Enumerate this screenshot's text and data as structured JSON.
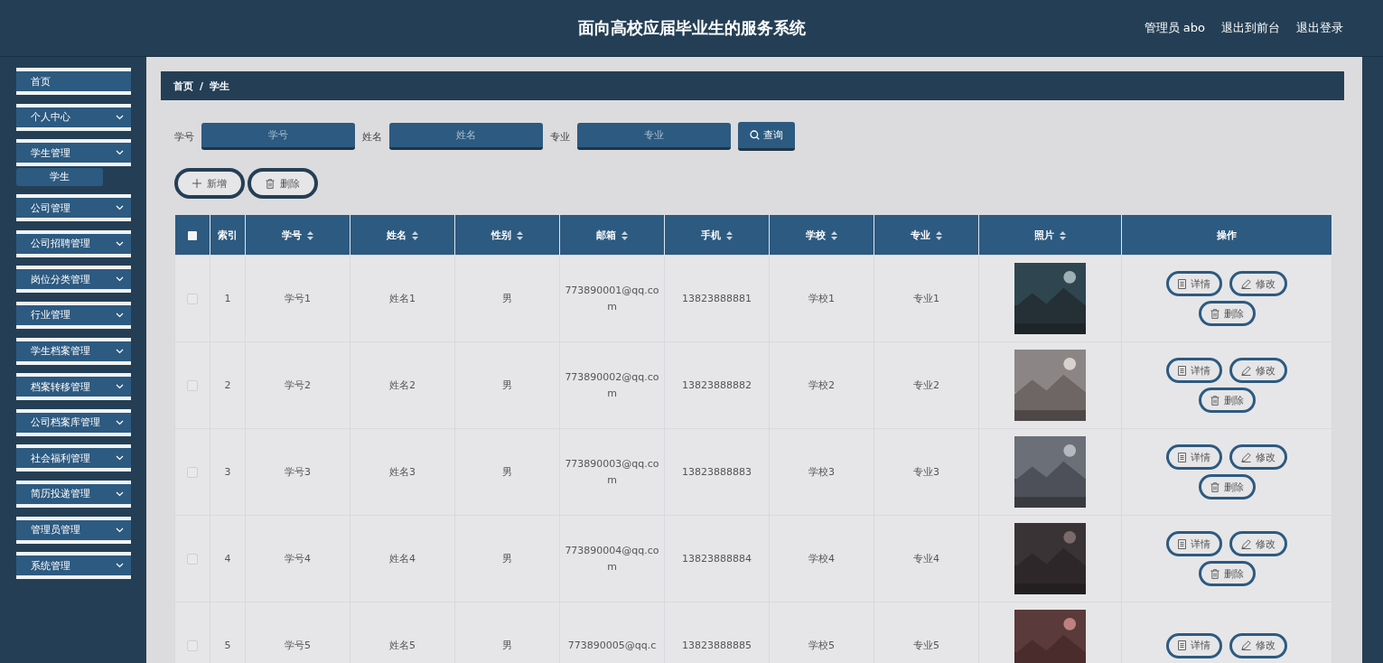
{
  "header": {
    "title": "面向高校应届毕业生的服务系统",
    "user": "管理员 abo",
    "links": [
      "退出到前台",
      "退出登录"
    ]
  },
  "sidebar": {
    "items": [
      {
        "label": "首页",
        "kind": "link"
      },
      {
        "label": "个人中心",
        "kind": "submenu"
      },
      {
        "label": "学生管理",
        "kind": "submenu",
        "children": [
          {
            "label": "学生",
            "selected": true
          }
        ]
      },
      {
        "label": "公司管理",
        "kind": "submenu"
      },
      {
        "label": "公司招聘管理",
        "kind": "submenu"
      },
      {
        "label": "岗位分类管理",
        "kind": "submenu"
      },
      {
        "label": "行业管理",
        "kind": "submenu"
      },
      {
        "label": "学生档案管理",
        "kind": "submenu"
      },
      {
        "label": "档案转移管理",
        "kind": "submenu"
      },
      {
        "label": "公司档案库管理",
        "kind": "submenu"
      },
      {
        "label": "社会福利管理",
        "kind": "submenu"
      },
      {
        "label": "简历投递管理",
        "kind": "submenu"
      },
      {
        "label": "管理员管理",
        "kind": "submenu"
      },
      {
        "label": "系统管理",
        "kind": "submenu"
      }
    ]
  },
  "breadcrumb": {
    "items": [
      "首页",
      "学生"
    ],
    "separator": "/"
  },
  "search": {
    "fields": [
      {
        "label": "学号",
        "placeholder": "学号"
      },
      {
        "label": "姓名",
        "placeholder": "姓名"
      },
      {
        "label": "专业",
        "placeholder": "专业"
      }
    ],
    "button": "查询"
  },
  "toolbar": [
    {
      "label": "新增",
      "kind": "add"
    },
    {
      "label": "删除",
      "kind": "delete"
    }
  ],
  "table": {
    "all_checked": false,
    "columns": [
      {
        "label": "索引",
        "sortable": false
      },
      {
        "label": "学号",
        "sortable": true
      },
      {
        "label": "姓名",
        "sortable": true
      },
      {
        "label": "性别",
        "sortable": true
      },
      {
        "label": "邮箱",
        "sortable": true
      },
      {
        "label": "手机",
        "sortable": true
      },
      {
        "label": "学校",
        "sortable": true
      },
      {
        "label": "专业",
        "sortable": true
      },
      {
        "label": "照片",
        "sortable": true
      },
      {
        "label": "操作",
        "sortable": false
      }
    ],
    "rows": [
      {
        "checked": false,
        "cells": [
          "1",
          "学号1",
          "姓名1",
          "男",
          "773890001@qq.com",
          "13823888881",
          "学校1",
          "专业1"
        ],
        "photo": {
          "kind": "picture"
        },
        "actions": [
          {
            "label": "详情",
            "kind": "detail"
          },
          {
            "label": "修改",
            "kind": "edit"
          },
          {
            "label": "删除",
            "kind": "delete"
          }
        ]
      },
      {
        "checked": false,
        "cells": [
          "2",
          "学号2",
          "姓名2",
          "男",
          "773890002@qq.com",
          "13823888882",
          "学校2",
          "专业2"
        ],
        "photo": {
          "kind": "picture"
        },
        "actions": [
          {
            "label": "详情",
            "kind": "detail"
          },
          {
            "label": "修改",
            "kind": "edit"
          },
          {
            "label": "删除",
            "kind": "delete"
          }
        ]
      },
      {
        "checked": false,
        "cells": [
          "3",
          "学号3",
          "姓名3",
          "男",
          "773890003@qq.com",
          "13823888883",
          "学校3",
          "专业3"
        ],
        "photo": {
          "kind": "picture"
        },
        "actions": [
          {
            "label": "详情",
            "kind": "detail"
          },
          {
            "label": "修改",
            "kind": "edit"
          },
          {
            "label": "删除",
            "kind": "delete"
          }
        ]
      },
      {
        "checked": false,
        "cells": [
          "4",
          "学号4",
          "姓名4",
          "男",
          "773890004@qq.com",
          "13823888884",
          "学校4",
          "专业4"
        ],
        "photo": {
          "kind": "picture"
        },
        "actions": [
          {
            "label": "详情",
            "kind": "detail"
          },
          {
            "label": "修改",
            "kind": "edit"
          },
          {
            "label": "删除",
            "kind": "delete"
          }
        ]
      },
      {
        "checked": false,
        "cells": [
          "5",
          "学号5",
          "姓名5",
          "男",
          "773890005@qq.c",
          "13823888885",
          "学校5",
          "专业5"
        ],
        "photo": {
          "kind": "picture"
        },
        "actions": [
          {
            "label": "详情",
            "kind": "detail"
          },
          {
            "label": "修改",
            "kind": "edit"
          }
        ]
      }
    ]
  }
}
